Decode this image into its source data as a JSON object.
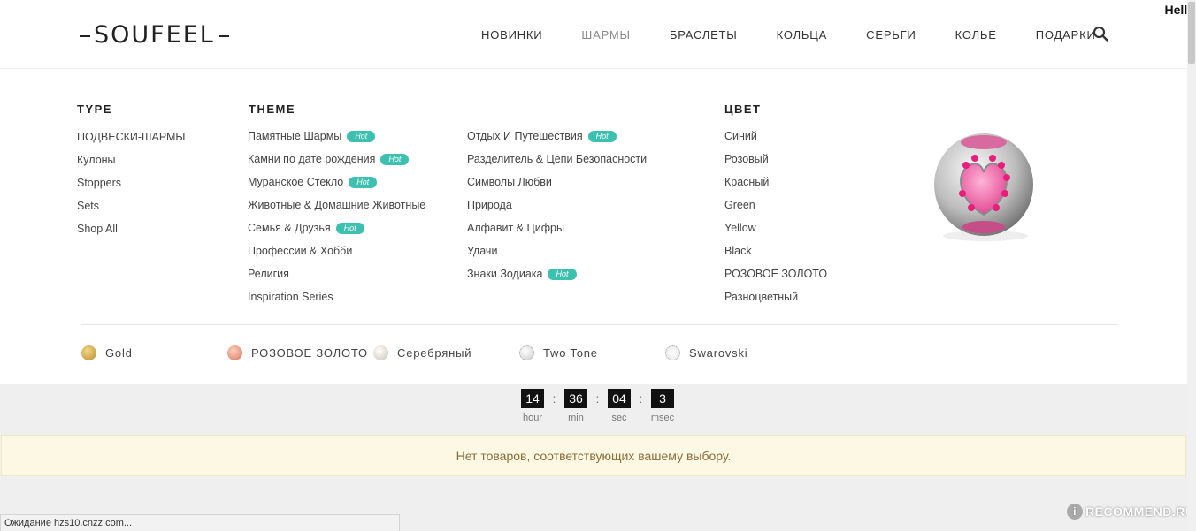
{
  "header": {
    "logo_text": "SOUFEEL",
    "nav": [
      "НОВИНКИ",
      "ШАРМЫ",
      "БРАСЛЕТЫ",
      "КОЛЬЦА",
      "СЕРЬГИ",
      "КОЛЬЕ",
      "ПОДАРКИ"
    ],
    "active_nav": "ШАРМЫ",
    "search_icon": "search-icon",
    "corner_text": "Helle"
  },
  "menu": {
    "type": {
      "title": "TYPE",
      "items": [
        "ПОДВЕСКИ-ШАРМЫ",
        "Кулоны",
        "Stoppers",
        "Sets",
        "Shop All"
      ]
    },
    "theme": {
      "title": "THEME",
      "col1": [
        {
          "label": "Памятные Шармы",
          "hot": "Hot"
        },
        {
          "label": "Камни по дате рождения",
          "hot": "Hot"
        },
        {
          "label": "Муранское Стекло",
          "hot": "Hot"
        },
        {
          "label": "Животные & Домашние Животные",
          "hot": ""
        },
        {
          "label": "Семья & Друзья",
          "hot": "Hot"
        },
        {
          "label": "Профессии & Хобби",
          "hot": ""
        },
        {
          "label": "Религия",
          "hot": ""
        },
        {
          "label": "Inspiration Series",
          "hot": ""
        }
      ],
      "col2": [
        {
          "label": "Отдых И Путешествия",
          "hot": "Hot"
        },
        {
          "label": "Разделитель & Цепи Безопасности",
          "hot": ""
        },
        {
          "label": "Символы Любви",
          "hot": ""
        },
        {
          "label": "Природа",
          "hot": ""
        },
        {
          "label": "Алфавит & Цифры",
          "hot": ""
        },
        {
          "label": "Удачи",
          "hot": ""
        },
        {
          "label": "Знаки Зодиака",
          "hot": "Hot"
        }
      ]
    },
    "color": {
      "title": "ЦВЕТ",
      "items": [
        "Синий",
        "Розовый",
        "Красный",
        "Green",
        "Yellow",
        "Black",
        "РОЗОВОЕ ЗОЛОТО",
        "Разноцветный"
      ]
    },
    "metals": [
      {
        "label": "Gold",
        "color": "#c9a34a"
      },
      {
        "label": "РОЗОВОЕ ЗОЛОТО",
        "color": "#e89a7e"
      },
      {
        "label": "Серебряный",
        "color": "#e0dbd0"
      },
      {
        "label": "Two Tone",
        "color": "#f4f4f4"
      },
      {
        "label": "Swarovski",
        "color": "#f8f8f8"
      }
    ]
  },
  "timer": {
    "hour": "14",
    "min": "36",
    "sec": "04",
    "msec": "3",
    "hour_label": "hour",
    "min_label": "min",
    "sec_label": "sec",
    "msec_label": "msec",
    "separator": ":"
  },
  "notice": "Нет товаров, соответствующих вашему выбору.",
  "status_bar": "Ожидание hzs10.cnzz.com...",
  "watermark": "RECOMMEND.RU",
  "colors": {
    "hot_badge": "#3cc0b0",
    "notice_bg": "#fcf8e3",
    "notice_text": "#8a6d3b"
  }
}
